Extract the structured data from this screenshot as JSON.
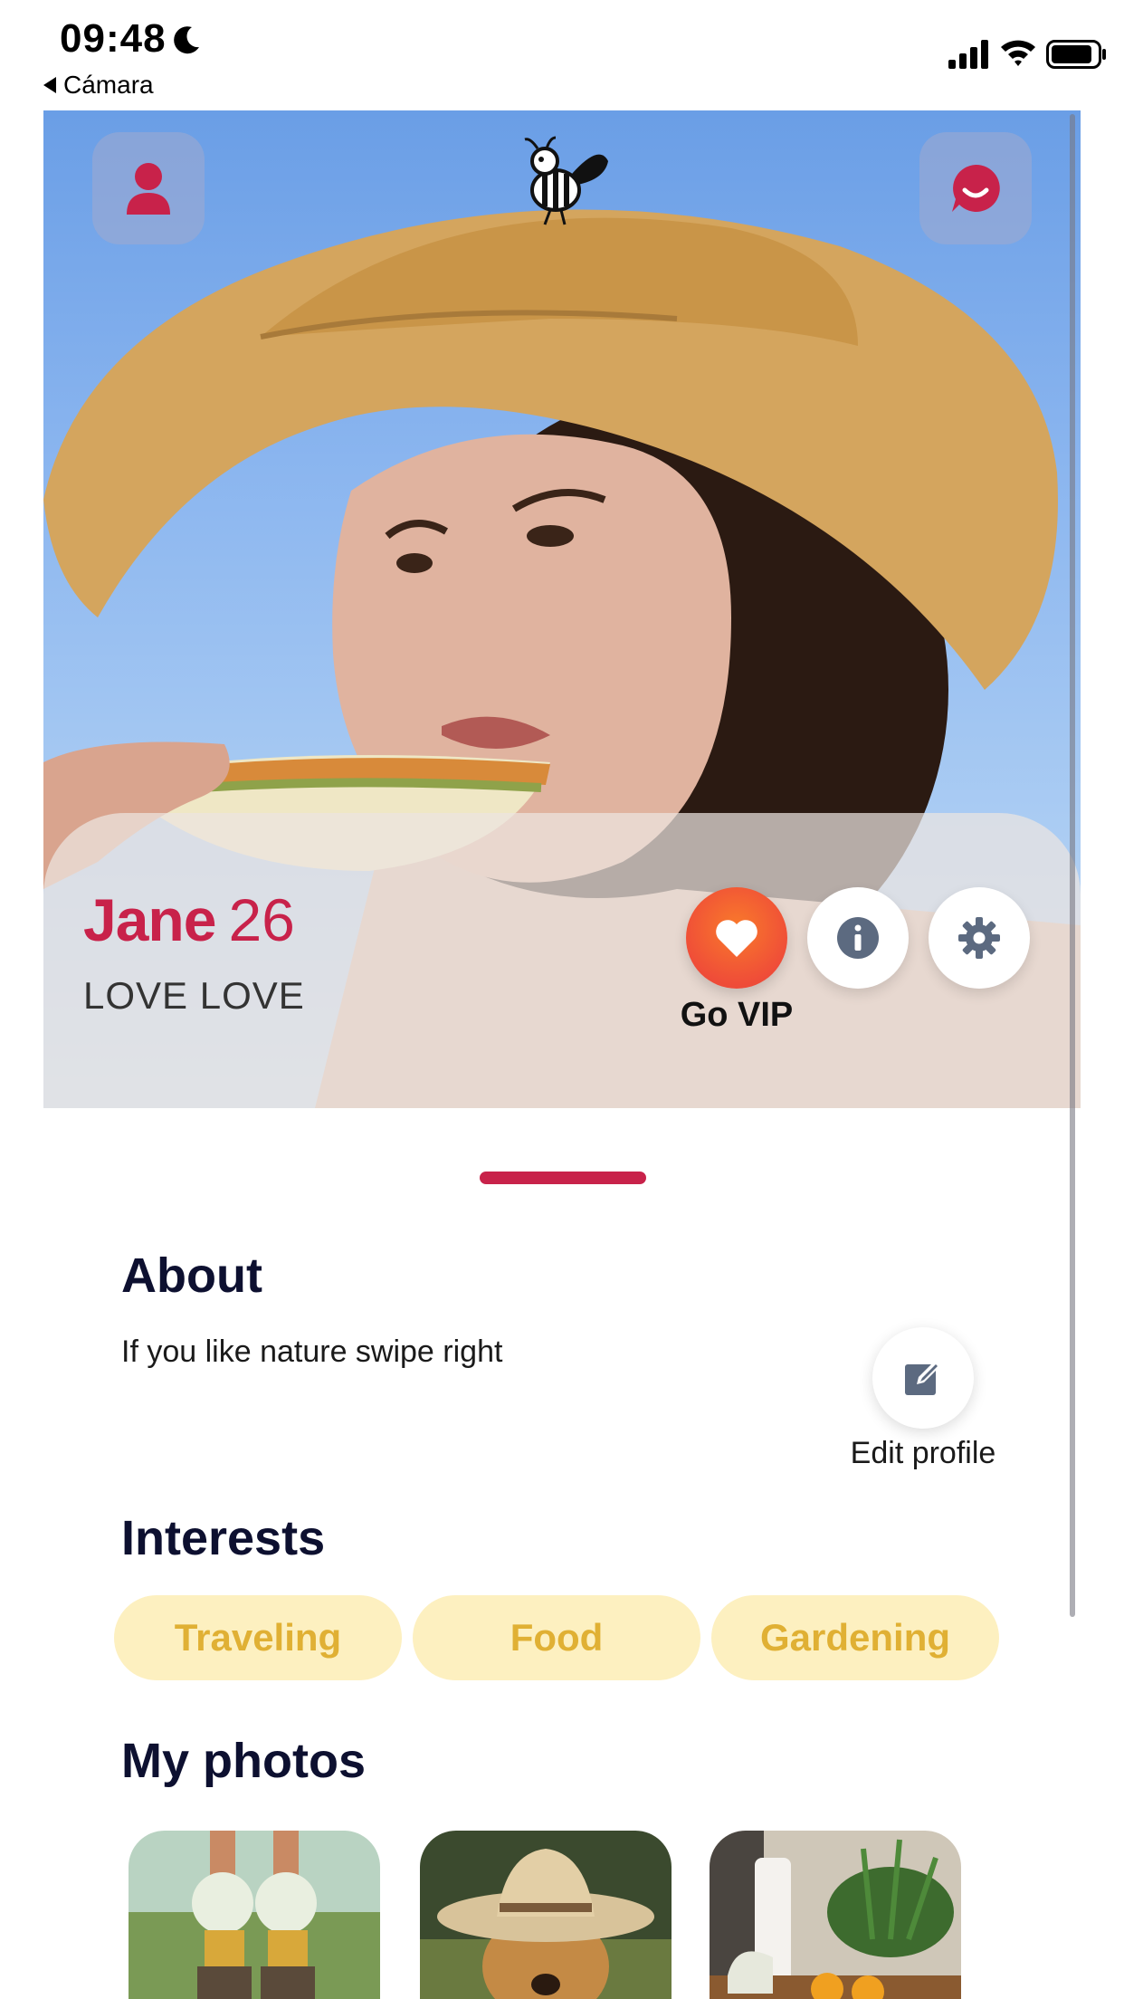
{
  "status_bar": {
    "time": "09:48",
    "back_label": "Cámara",
    "icons": [
      "moon-icon",
      "signal-icon",
      "wifi-icon",
      "battery-icon"
    ]
  },
  "header": {
    "left_button_icon": "user-icon",
    "right_button_icon": "chat-icon",
    "logo": "bee-logo"
  },
  "profile": {
    "name": "Jane",
    "age": "26",
    "tagline": "LOVE LOVE",
    "actions": {
      "vip_label": "Go VIP",
      "vip_icon": "heart-icon",
      "info_icon": "info-icon",
      "settings_icon": "gear-icon"
    }
  },
  "about": {
    "title": "About",
    "text": "If you like nature swipe right",
    "edit_label": "Edit profile",
    "edit_icon": "edit-icon"
  },
  "interests": {
    "title": "Interests",
    "items": [
      "Traveling",
      "Food",
      "Gardening"
    ]
  },
  "photos": {
    "title": "My photos",
    "thumbnails": [
      "flowers-in-boots-photo",
      "dog-in-hat-photo",
      "kitchen-plants-photo"
    ]
  },
  "colors": {
    "brand": "#c8224a",
    "chip_bg": "#fdf0c0",
    "chip_text": "#e0b034",
    "heading": "#0d1030",
    "vip": "#ef4d38"
  }
}
